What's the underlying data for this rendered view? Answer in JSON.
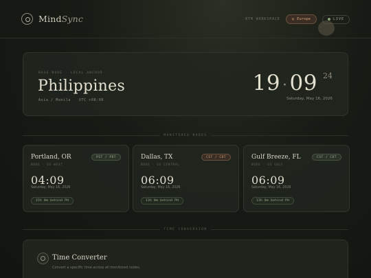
{
  "app": {
    "brand_prefix": "Mind",
    "brand_suffix": "Sync",
    "header_label": "RTM WORKSPACE",
    "region_button": "Europe",
    "live_label": "LIVE"
  },
  "hero": {
    "tag": "BASE NODE · LOCAL ANCHOR",
    "country": "Philippines",
    "zone": "Asia / Manila",
    "utc": "UTC +08:00",
    "hours": "19",
    "minutes": "09",
    "seconds": "24",
    "date": "Saturday, May 16, 2026"
  },
  "sections": {
    "monitored": "MONITORED NODES",
    "conversion": "TIME CONVERSION"
  },
  "cities": [
    {
      "name": "Portland, OR",
      "sub": "NODE · US WEST",
      "badge": "PST / PDT",
      "time": "04:09",
      "date": "Saturday, May 16, 2026",
      "diff": "15h 0m behind PH"
    },
    {
      "name": "Dallas, TX",
      "sub": "NODE · US CENTRAL",
      "badge": "CST / CDT",
      "time": "06:09",
      "date": "Saturday, May 16, 2026",
      "diff": "13h 0m behind PH"
    },
    {
      "name": "Gulf Breeze, FL",
      "sub": "NODE · US GULF",
      "badge": "CST / CDT",
      "time": "06:09",
      "date": "Saturday, May 16, 2026",
      "diff": "13h 0m behind PH"
    }
  ],
  "converter": {
    "title": "Time Converter",
    "subtitle": "Convert a specific time across all monitored nodes."
  },
  "colors": {
    "accent_green": "#9bb08c",
    "accent_amber": "#d2a17c",
    "background": "#161913"
  }
}
